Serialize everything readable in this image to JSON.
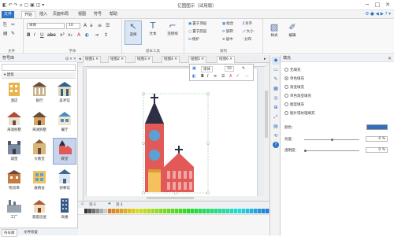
{
  "app": {
    "title": "亿图图示（试用版）",
    "window_controls": [
      "─",
      "□",
      "✕"
    ],
    "quick_access": [
      "◧",
      "↶",
      "↷",
      "▫",
      "▢",
      "▣",
      "◫",
      "▾"
    ]
  },
  "menu": {
    "items": [
      "文件",
      "开始",
      "插入",
      "页面布局",
      "视图",
      "符号",
      "帮助"
    ],
    "active": "开始",
    "right_icons": [
      "⚙",
      "●",
      "◀",
      "▶",
      "?",
      "▾"
    ]
  },
  "ribbon": {
    "groups": [
      "文件",
      "字体",
      "基本工具",
      "排列"
    ],
    "font_name": "宋体",
    "font_size": "10",
    "tools": [
      "选择",
      "文本",
      "连接线"
    ],
    "arrange": [
      "置于顶层",
      "置于底层",
      "组合",
      "对齐",
      "旋转",
      "大小",
      "分布",
      "居中",
      "保护"
    ],
    "style": "样式",
    "edit": "编辑"
  },
  "library": {
    "title": "符号库",
    "category": "建筑",
    "shapes": [
      {
        "label": "酒店"
      },
      {
        "label": "银行"
      },
      {
        "label": "美术馆"
      },
      {
        "label": "海滩别墅"
      },
      {
        "label": "海滩别墅"
      },
      {
        "label": "餐厅"
      },
      {
        "label": "城堡"
      },
      {
        "label": "大教堂"
      },
      {
        "label": "教堂"
      },
      {
        "label": "物流埠"
      },
      {
        "label": "展销会"
      },
      {
        "label": "领事馆"
      },
      {
        "label": "工厂"
      },
      {
        "label": "家庭房屋"
      },
      {
        "label": "高楼"
      }
    ],
    "tabs": [
      "符号库",
      "文件恢复"
    ]
  },
  "doc_tabs": [
    "绘图1",
    "绘图2",
    "绘图3",
    "绘图4",
    "绘图5",
    "绘图6"
  ],
  "float_toolbar": {
    "font": "宋体",
    "size": "10"
  },
  "page_tabs": [
    "页-1",
    "页-1"
  ],
  "fill_panel": {
    "title": "填充",
    "options": [
      "无填充",
      "单色填充",
      "渐变填充",
      "单色渐变填充",
      "图案填充",
      "图片或纹理填充"
    ],
    "color_label": "颜色：",
    "brightness_label": "亮度：",
    "brightness_value": "0 %",
    "transparency_label": "透明度：",
    "transparency_value": "0 %",
    "color": "#2f6fbf"
  },
  "right_tools": [
    "◆",
    "▭",
    "✎",
    "▦",
    "◎",
    "⊞",
    "⤢",
    "▤",
    "⟲",
    "?"
  ]
}
